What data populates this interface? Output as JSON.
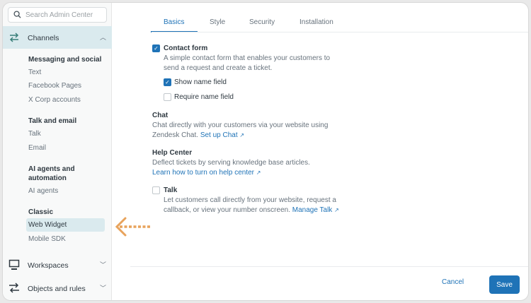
{
  "sidebar": {
    "search_placeholder": "Search Admin Center",
    "channels": "Channels",
    "groups": [
      {
        "title": "Messaging and social",
        "items": [
          "Text",
          "Facebook Pages",
          "X Corp accounts"
        ]
      },
      {
        "title": "Talk and email",
        "items": [
          "Talk",
          "Email"
        ]
      },
      {
        "title": "AI agents and automation",
        "items": [
          "AI agents"
        ]
      },
      {
        "title": "Classic",
        "items": [
          "Web Widget",
          "Mobile SDK"
        ]
      }
    ],
    "workspaces": "Workspaces",
    "objects": "Objects and rules",
    "selected": "Web Widget"
  },
  "tabs": [
    "Basics",
    "Style",
    "Security",
    "Installation"
  ],
  "active_tab": "Basics",
  "form": {
    "contact": {
      "label": "Contact form",
      "checked": true,
      "desc": "A simple contact form that enables your customers to send a request and create a ticket."
    },
    "show_name": {
      "label": "Show name field",
      "checked": true
    },
    "require_name": {
      "label": "Require name field",
      "checked": false
    },
    "chat": {
      "title": "Chat",
      "desc": "Chat directly with your customers via your website using Zendesk Chat.",
      "link": "Set up Chat"
    },
    "help": {
      "title": "Help Center",
      "desc": "Deflect tickets by serving knowledge base articles.",
      "link": "Learn how to turn on help center"
    },
    "talk": {
      "label": "Talk",
      "checked": false,
      "desc": "Let customers call directly from your website, request a callback, or view your number onscreen.",
      "link": "Manage Talk"
    }
  },
  "footer": {
    "cancel": "Cancel",
    "save": "Save"
  },
  "colors": {
    "accent": "#1f73b7",
    "selected_bg": "#daeaee",
    "arrow": "#e8a35c"
  }
}
